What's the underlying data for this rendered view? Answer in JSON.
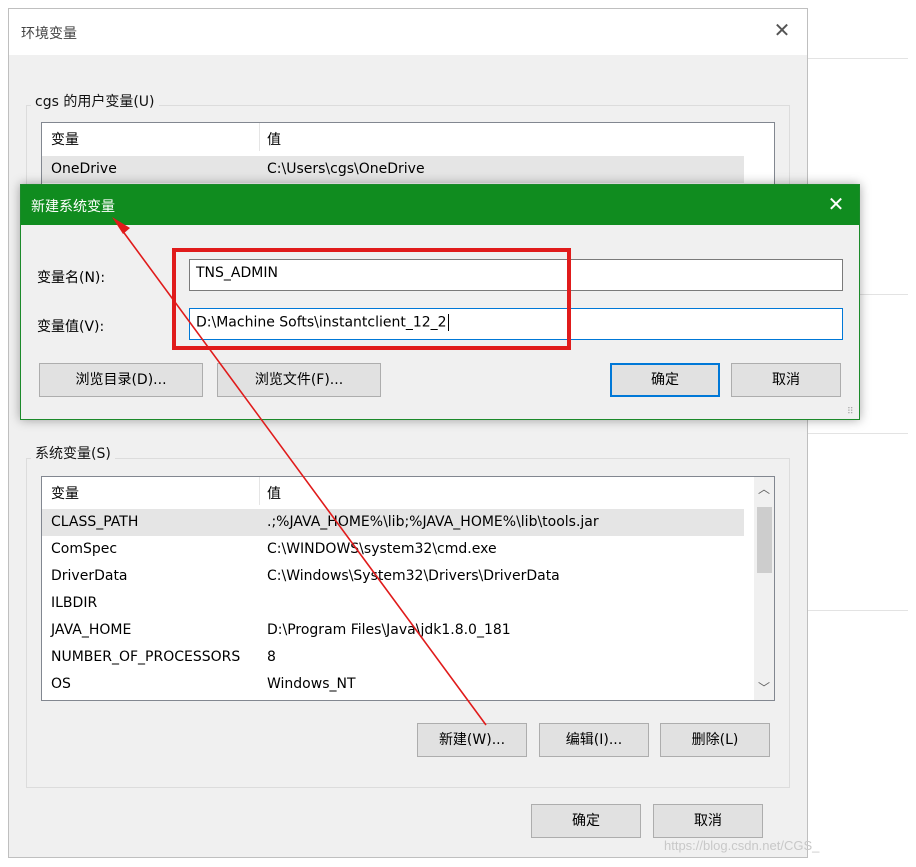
{
  "window": {
    "title": "环境变量",
    "user_group_label": "cgs 的用户变量(U)",
    "system_group_label": "系统变量(S)",
    "ok_label": "确定",
    "cancel_label": "取消"
  },
  "user_vars": {
    "col_name": "变量",
    "col_value": "值",
    "rows": [
      {
        "name": "OneDrive",
        "value": "C:\\Users\\cgs\\OneDrive"
      }
    ]
  },
  "system_vars": {
    "col_name": "变量",
    "col_value": "值",
    "rows": [
      {
        "name": "CLASS_PATH",
        "value": ".;%JAVA_HOME%\\lib;%JAVA_HOME%\\lib\\tools.jar"
      },
      {
        "name": "ComSpec",
        "value": "C:\\WINDOWS\\system32\\cmd.exe"
      },
      {
        "name": "DriverData",
        "value": "C:\\Windows\\System32\\Drivers\\DriverData"
      },
      {
        "name": "ILBDIR",
        "value": ""
      },
      {
        "name": "JAVA_HOME",
        "value": "D:\\Program Files\\Java\\jdk1.8.0_181"
      },
      {
        "name": "NUMBER_OF_PROCESSORS",
        "value": "8"
      },
      {
        "name": "OS",
        "value": "Windows_NT"
      }
    ],
    "new_label": "新建(W)...",
    "edit_label": "编辑(I)...",
    "delete_label": "删除(L)"
  },
  "dialog": {
    "title": "新建系统变量",
    "name_label": "变量名(N):",
    "value_label": "变量值(V):",
    "name_value": "TNS_ADMIN",
    "value_value": "D:\\Machine Softs\\instantclient_12_2",
    "browse_dir_label": "浏览目录(D)...",
    "browse_file_label": "浏览文件(F)...",
    "ok_label": "确定",
    "cancel_label": "取消"
  },
  "watermark": "https://blog.csdn.net/CGS_",
  "colors": {
    "dialog_title_bg": "#108c1f",
    "highlight": "#e01b1b",
    "focus_border": "#0078d7"
  }
}
